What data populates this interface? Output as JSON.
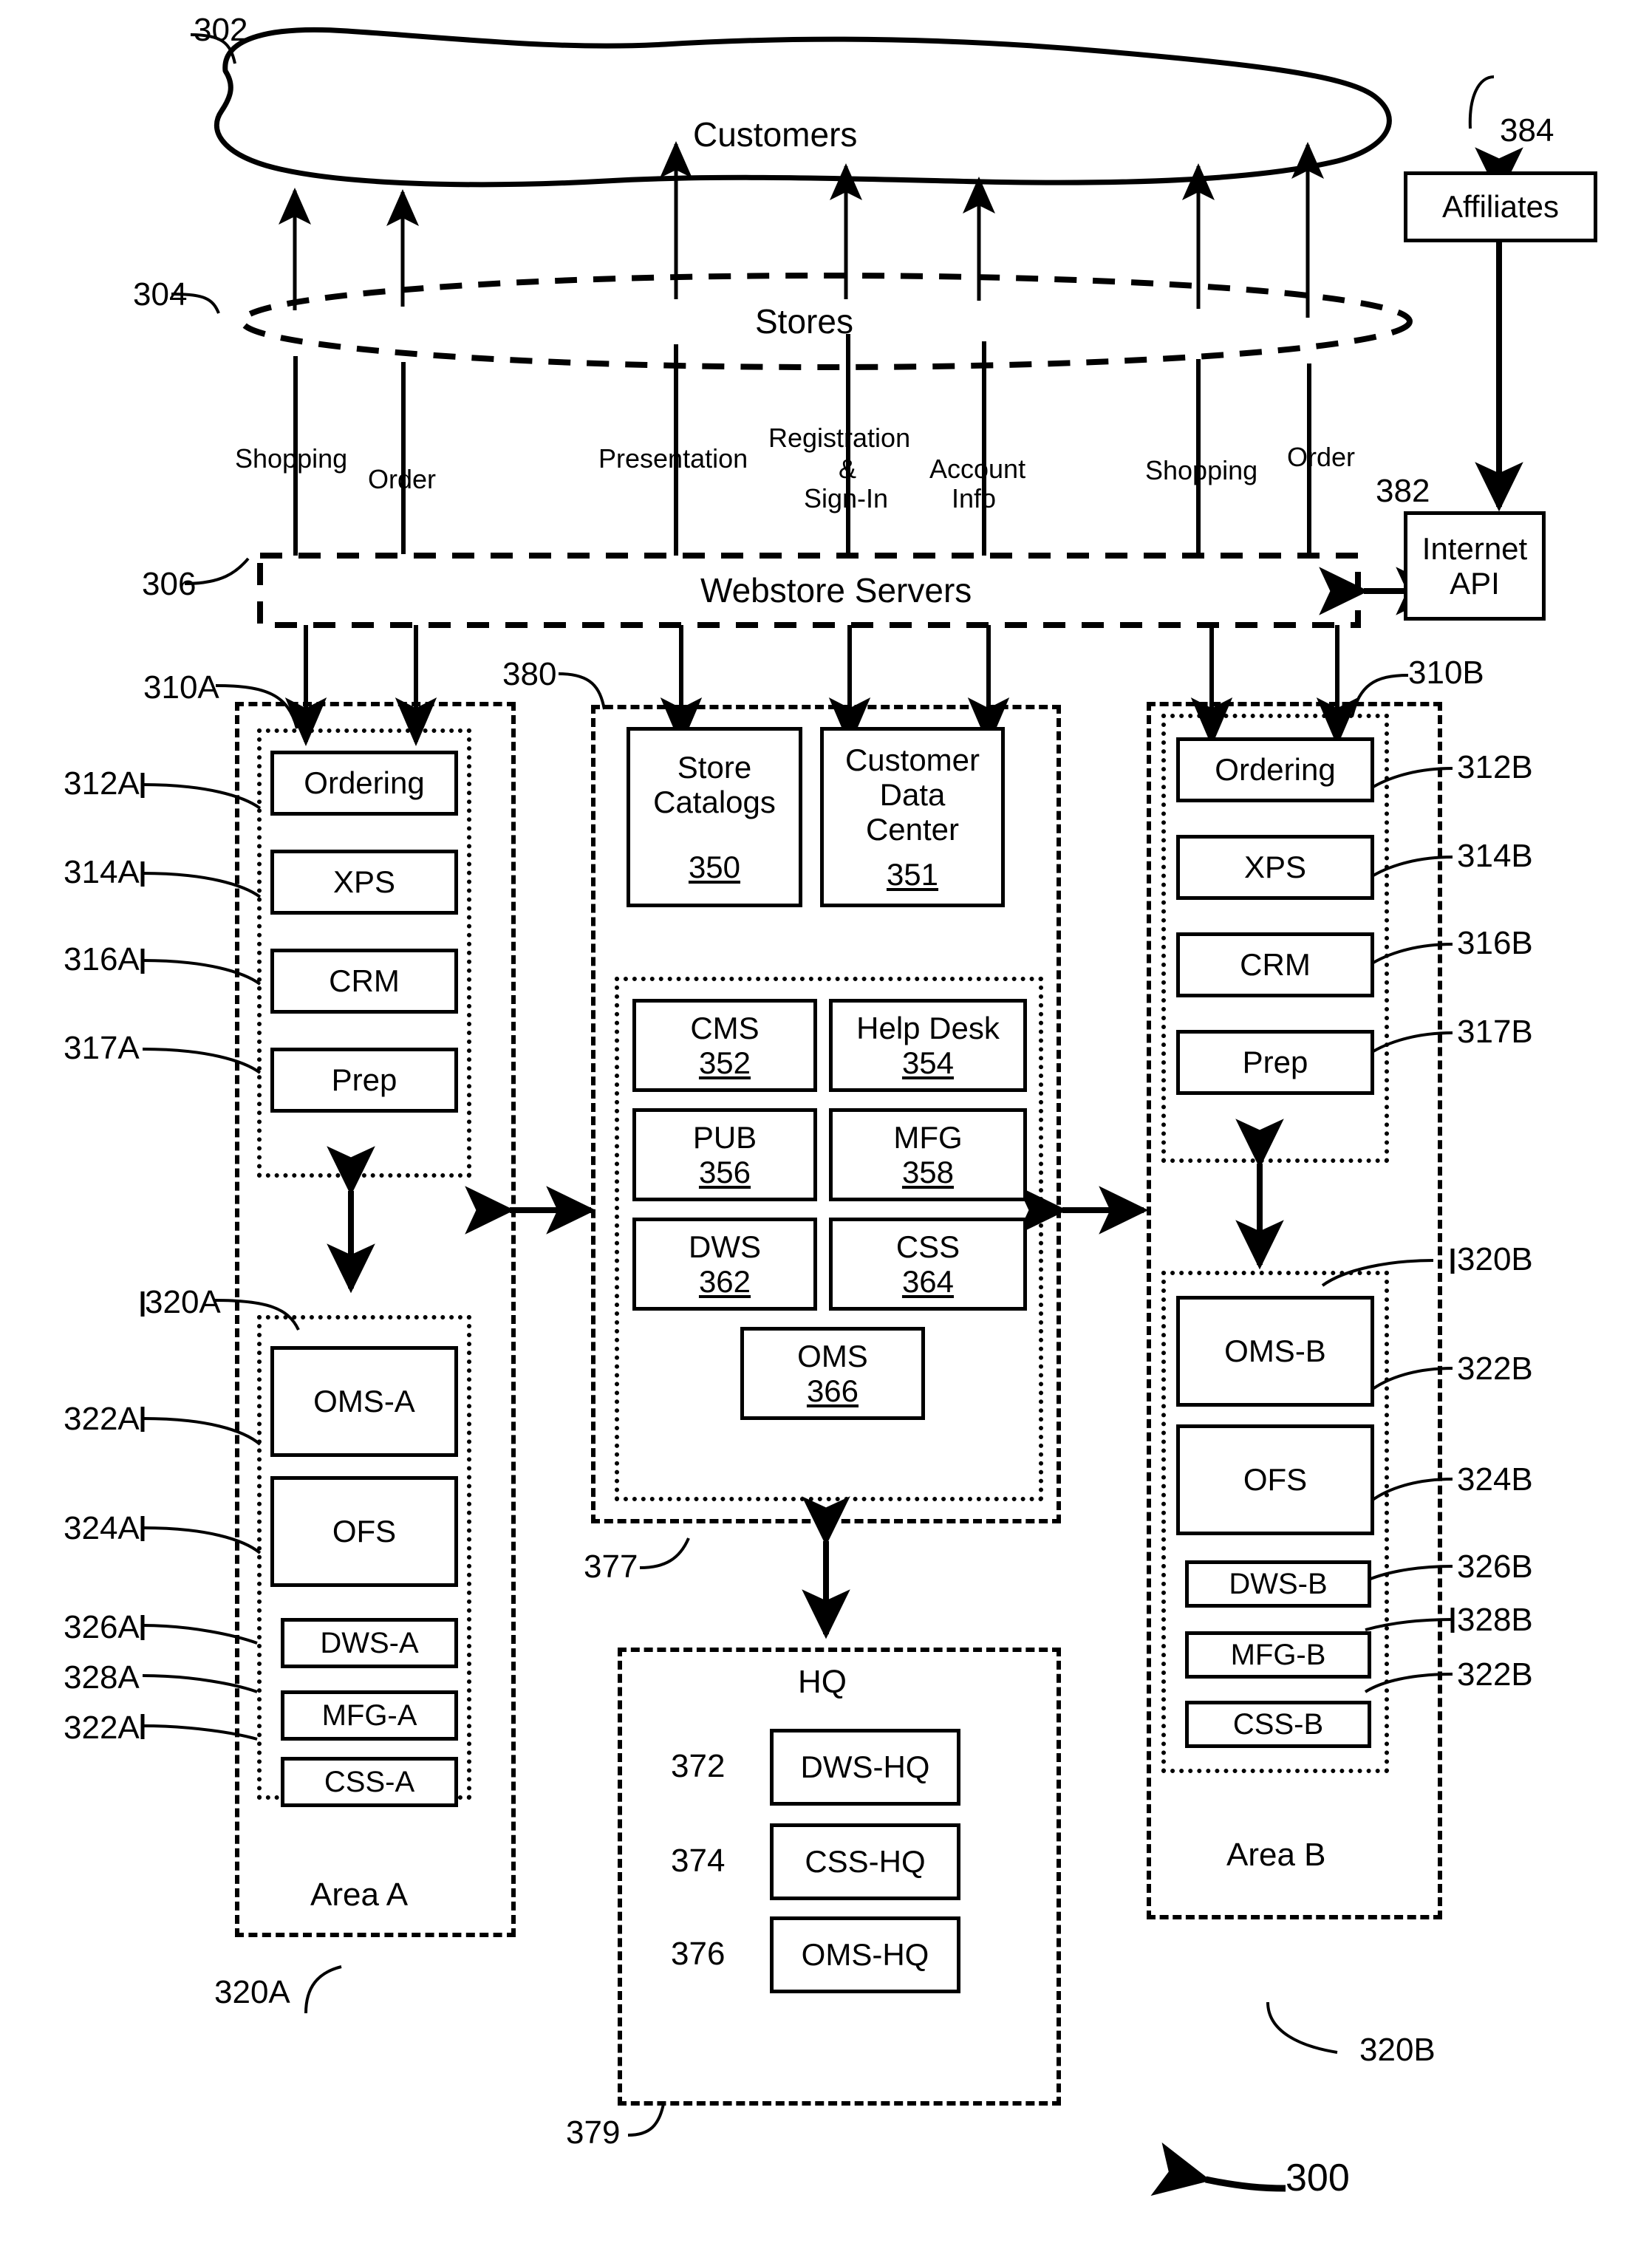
{
  "figure": {
    "ref_bottom": "300"
  },
  "cloud": {
    "label": "Customers",
    "ref": "302"
  },
  "stores": {
    "label": "Stores",
    "ref": "304"
  },
  "webstore": {
    "label": "Webstore Servers",
    "ref": "306"
  },
  "flow_labels": [
    {
      "text": "Shopping"
    },
    {
      "text": "Order"
    },
    {
      "text": "Presentation"
    },
    {
      "text": "Registration"
    },
    {
      "text": "&"
    },
    {
      "text": "Sign-In"
    },
    {
      "text": "Account"
    },
    {
      "text": "Info"
    },
    {
      "text": "Shopping"
    },
    {
      "text": "Order"
    }
  ],
  "affiliates": {
    "label": "Affiliates",
    "ref": "384"
  },
  "internet_api": {
    "line1": "Internet",
    "line2": "API",
    "ref": "382"
  },
  "area_a": {
    "title": "Area A",
    "ref_top": "310A",
    "ref_group": "320A",
    "ref_group_bottom": "320A",
    "front_office": [
      {
        "label": "Ordering",
        "ref": "312A"
      },
      {
        "label": "XPS",
        "ref": "314A"
      },
      {
        "label": "CRM",
        "ref": "316A"
      },
      {
        "label": "Prep",
        "ref": "317A"
      }
    ],
    "back_office": [
      {
        "label": "OMS-A",
        "ref": "322A"
      },
      {
        "label": "OFS",
        "ref": "324A"
      },
      {
        "label": "DWS-A",
        "ref": "326A"
      },
      {
        "label": "MFG-A",
        "ref": "328A"
      },
      {
        "label": "CSS-A",
        "ref": "322A"
      }
    ]
  },
  "area_b": {
    "title": "Area B",
    "ref_top": "310B",
    "ref_group": "320B",
    "ref_group_bottom": "320B",
    "front_office": [
      {
        "label": "Ordering",
        "ref": "312B"
      },
      {
        "label": "XPS",
        "ref": "314B"
      },
      {
        "label": "CRM",
        "ref": "316B"
      },
      {
        "label": "Prep",
        "ref": "317B"
      }
    ],
    "back_office": [
      {
        "label": "OMS-B",
        "ref": "322B"
      },
      {
        "label": "OFS",
        "ref": "324B"
      },
      {
        "label": "DWS-B",
        "ref": "326B"
      },
      {
        "label": "MFG-B",
        "ref": "328B"
      },
      {
        "label": "CSS-B",
        "ref": "322B"
      }
    ]
  },
  "central": {
    "ref": "380",
    "ref_services": "377",
    "top_boxes": [
      {
        "line1": "Store",
        "line2": "Catalogs",
        "num": "350"
      },
      {
        "line1": "Customer",
        "line2": "Data",
        "line3": "Center",
        "num": "351"
      }
    ],
    "services": [
      {
        "label": "CMS",
        "num": "352"
      },
      {
        "label": "Help Desk",
        "num": "354"
      },
      {
        "label": "PUB",
        "num": "356"
      },
      {
        "label": "MFG",
        "num": "358"
      },
      {
        "label": "DWS",
        "num": "362"
      },
      {
        "label": "CSS",
        "num": "364"
      },
      {
        "label": "OMS",
        "num": "366"
      }
    ]
  },
  "hq": {
    "title": "HQ",
    "ref": "379",
    "items": [
      {
        "label": "DWS-HQ",
        "ref": "372"
      },
      {
        "label": "CSS-HQ",
        "ref": "374"
      },
      {
        "label": "OMS-HQ",
        "ref": "376"
      }
    ]
  }
}
